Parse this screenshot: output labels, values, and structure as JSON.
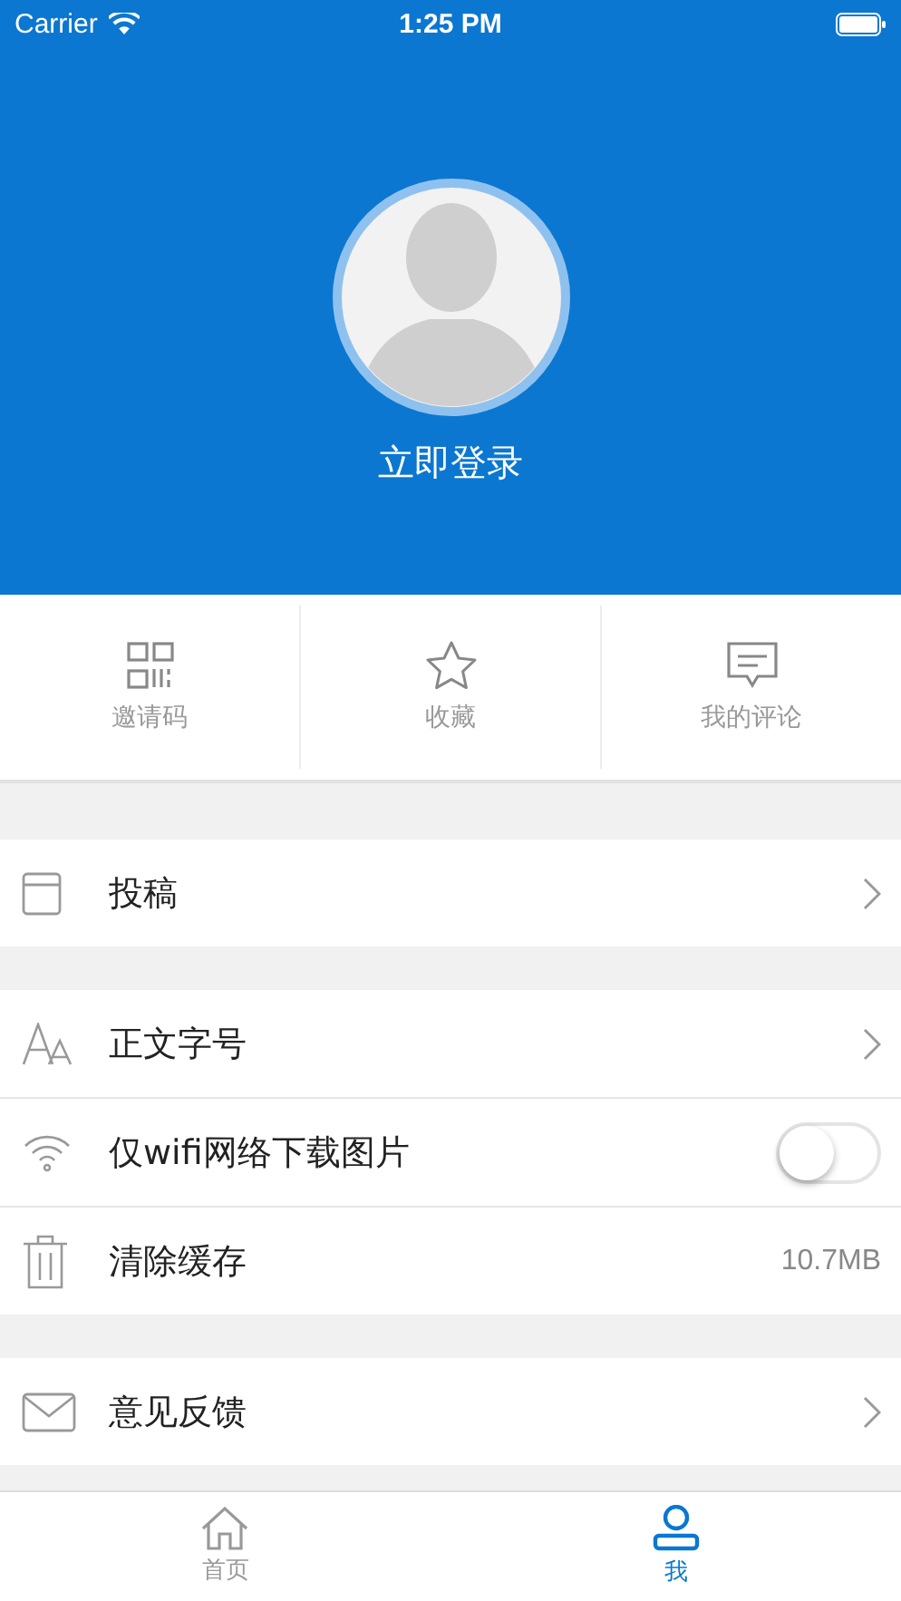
{
  "status_bar": {
    "carrier": "Carrier",
    "time": "1:25 PM"
  },
  "profile": {
    "login_label": "立即登录"
  },
  "shortcuts": [
    {
      "label": "邀请码"
    },
    {
      "label": "收藏"
    },
    {
      "label": "我的评论"
    }
  ],
  "groups": [
    [
      {
        "kind": "link",
        "label": "投稿"
      }
    ],
    [
      {
        "kind": "link",
        "label": "正文字号"
      },
      {
        "kind": "toggle",
        "label": "仅wifi网络下载图片",
        "on": false
      },
      {
        "kind": "value",
        "label": "清除缓存",
        "value": "10.7MB"
      }
    ],
    [
      {
        "kind": "link",
        "label": "意见反馈"
      }
    ]
  ],
  "tab_bar": [
    {
      "label": "首页",
      "selected": false
    },
    {
      "label": "我",
      "selected": true
    }
  ]
}
